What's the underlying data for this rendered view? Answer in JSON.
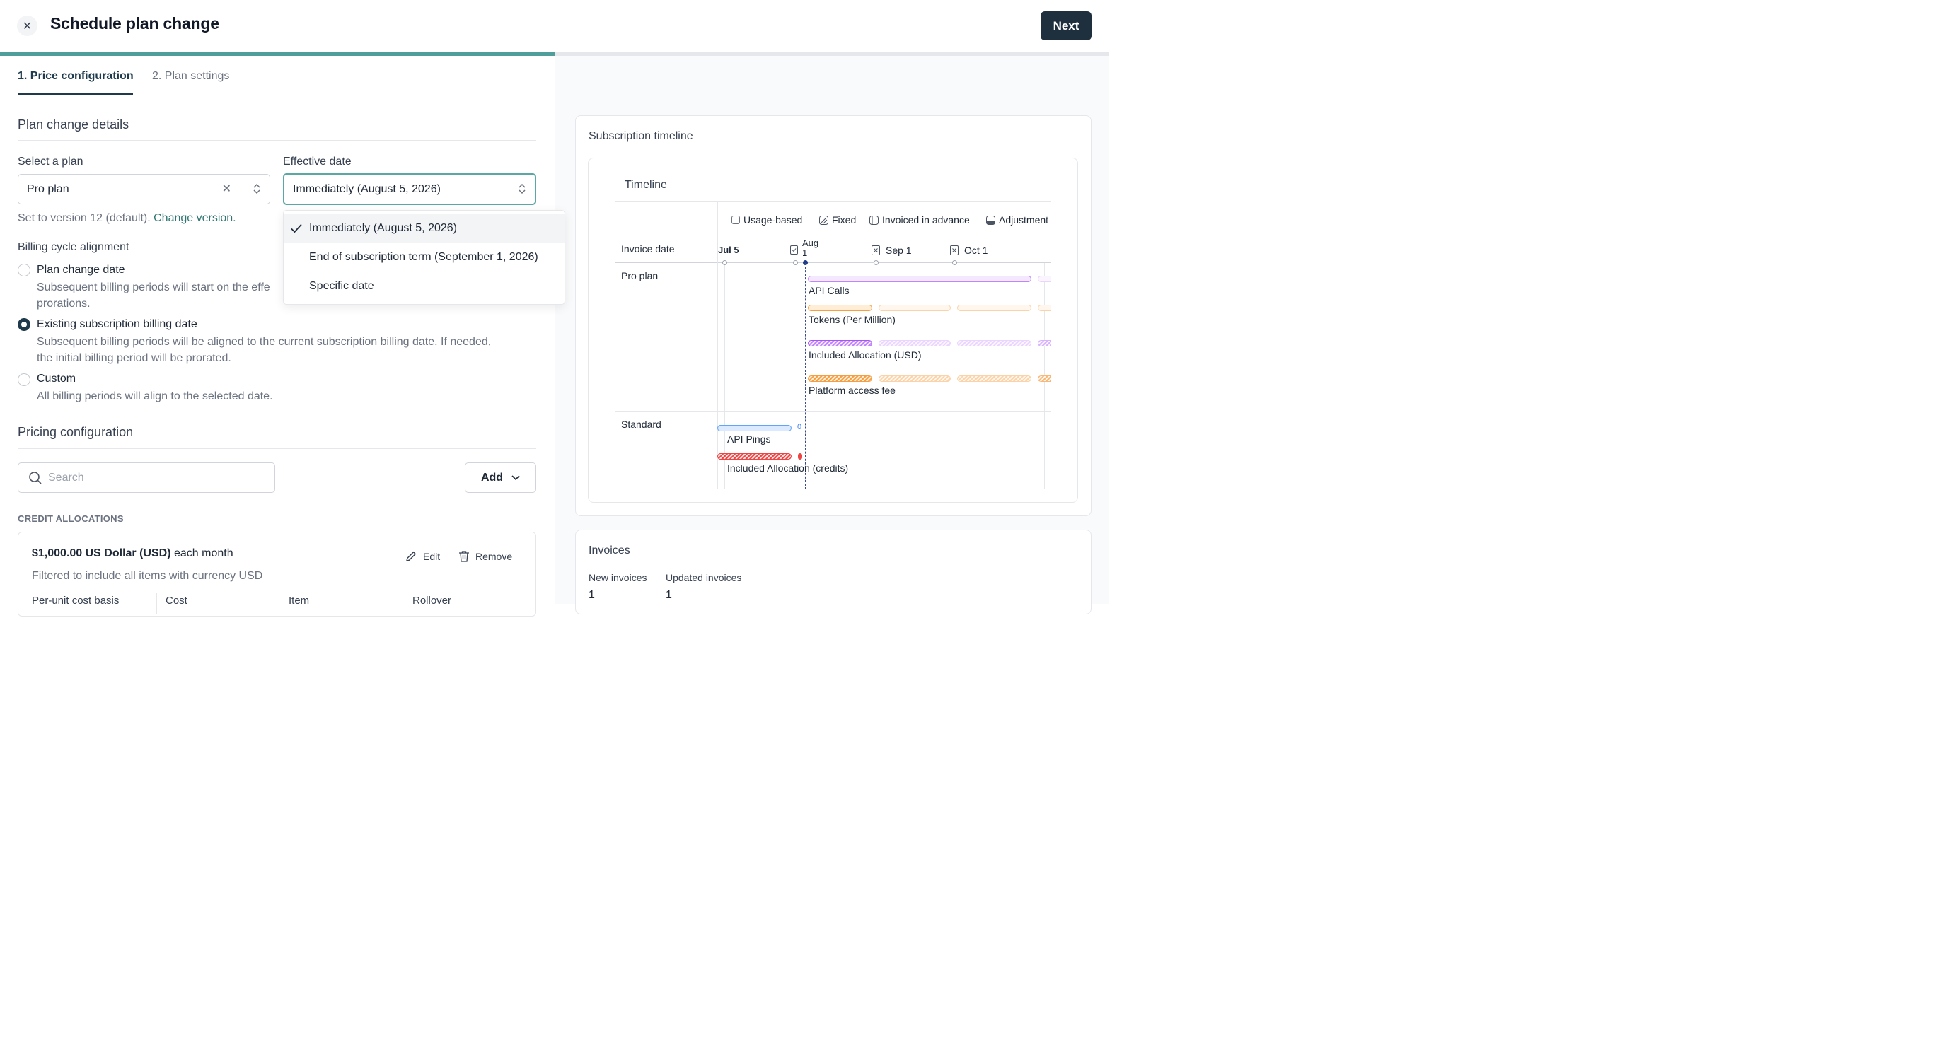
{
  "header": {
    "title": "Schedule plan change",
    "next_label": "Next",
    "progress_percent": 50
  },
  "tabs": [
    {
      "label": "1. Price configuration"
    },
    {
      "label": "2. Plan settings"
    }
  ],
  "plan_change": {
    "section_title": "Plan change details",
    "plan_label": "Select a plan",
    "plan_value": "Pro plan",
    "effective_label": "Effective date",
    "effective_value": "Immediately (August 5, 2026)",
    "version_text": "Set to version 12 (default).",
    "version_link": "Change version.",
    "billing_title": "Billing cycle alignment",
    "options": [
      {
        "title": "Plan change date",
        "desc_line1": "Subsequent billing periods will start on the effe",
        "desc_line2": "prorations."
      },
      {
        "title": "Existing subscription billing date",
        "desc_line1": "Subsequent billing periods will be aligned to the current subscription billing date. If needed,",
        "desc_line2": "the initial billing period will be prorated."
      },
      {
        "title": "Custom",
        "desc_line1": "All billing periods will align to the selected date."
      }
    ]
  },
  "dropdown": {
    "items": [
      "Immediately (August 5, 2026)",
      "End of subscription term (September 1, 2026)",
      "Specific date"
    ]
  },
  "pricing": {
    "section_title": "Pricing configuration",
    "search_placeholder": "Search",
    "add_label": "Add",
    "credit_heading": "CREDIT ALLOCATIONS",
    "credit_amount": "$1,000.00 US Dollar (USD)",
    "credit_freq": " each month",
    "credit_filter": "Filtered to include all items with currency USD",
    "edit_label": "Edit",
    "remove_label": "Remove",
    "columns": [
      "Per-unit cost basis",
      "Cost",
      "Item",
      "Rollover"
    ]
  },
  "timeline": {
    "panel_title": "Subscription timeline",
    "inner_title": "Timeline",
    "legend": [
      "Usage-based",
      "Fixed",
      "Invoiced in advance",
      "Adjustment"
    ],
    "invoice_date_label": "Invoice date",
    "dates": [
      "Jul 5",
      "Aug 1",
      "Sep 1",
      "Oct 1"
    ],
    "groups": [
      {
        "name": "Pro plan",
        "items": [
          "API Calls",
          "Tokens (Per Million)",
          "Included Allocation (USD)",
          "Platform access fee"
        ]
      },
      {
        "name": "Standard",
        "items": [
          "API Pings",
          "Included Allocation (credits)"
        ]
      }
    ],
    "marker_value": "0"
  },
  "invoices": {
    "title": "Invoices",
    "new_label": "New invoices",
    "new_value": "1",
    "updated_label": "Updated invoices",
    "updated_value": "1"
  },
  "colors": {
    "primary": "#1e2f3d",
    "accent": "#4f9e9b",
    "purple": "#a855f7",
    "orange": "#f59e42",
    "blue": "#60a5fa",
    "red": "#ef4444"
  }
}
